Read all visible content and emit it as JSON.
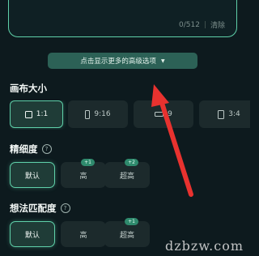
{
  "prompt": {
    "counter": "0/512",
    "clear_label": "清除"
  },
  "advanced_button": {
    "label": "点击显示更多的高级选项"
  },
  "canvas_size": {
    "title": "画布大小",
    "options": [
      {
        "label": "1:1",
        "selected": true
      },
      {
        "label": "9:16",
        "selected": false
      },
      {
        "label": "16:9",
        "visible_text": "9",
        "selected": false
      },
      {
        "label": "3:4",
        "visible_text": "3:4",
        "selected": false
      }
    ]
  },
  "fineness": {
    "title": "精细度",
    "help_icon": "?",
    "options": [
      {
        "label": "默认",
        "selected": true
      },
      {
        "label": "高",
        "badge": "+1"
      },
      {
        "label": "超高",
        "badge": "+2"
      }
    ]
  },
  "idea_match": {
    "title": "想法匹配度",
    "help_icon": "?",
    "options": [
      {
        "label": "默认",
        "selected": true
      },
      {
        "label": "高"
      },
      {
        "label": "超高",
        "badge": "+1"
      }
    ]
  },
  "annotation": {
    "arrow_color": "#e8322f"
  },
  "watermark": {
    "text": "dzbzw.com"
  },
  "colors": {
    "accent": "#5fd0a9",
    "background": "#0d1a1e",
    "button": "#2c6156"
  }
}
